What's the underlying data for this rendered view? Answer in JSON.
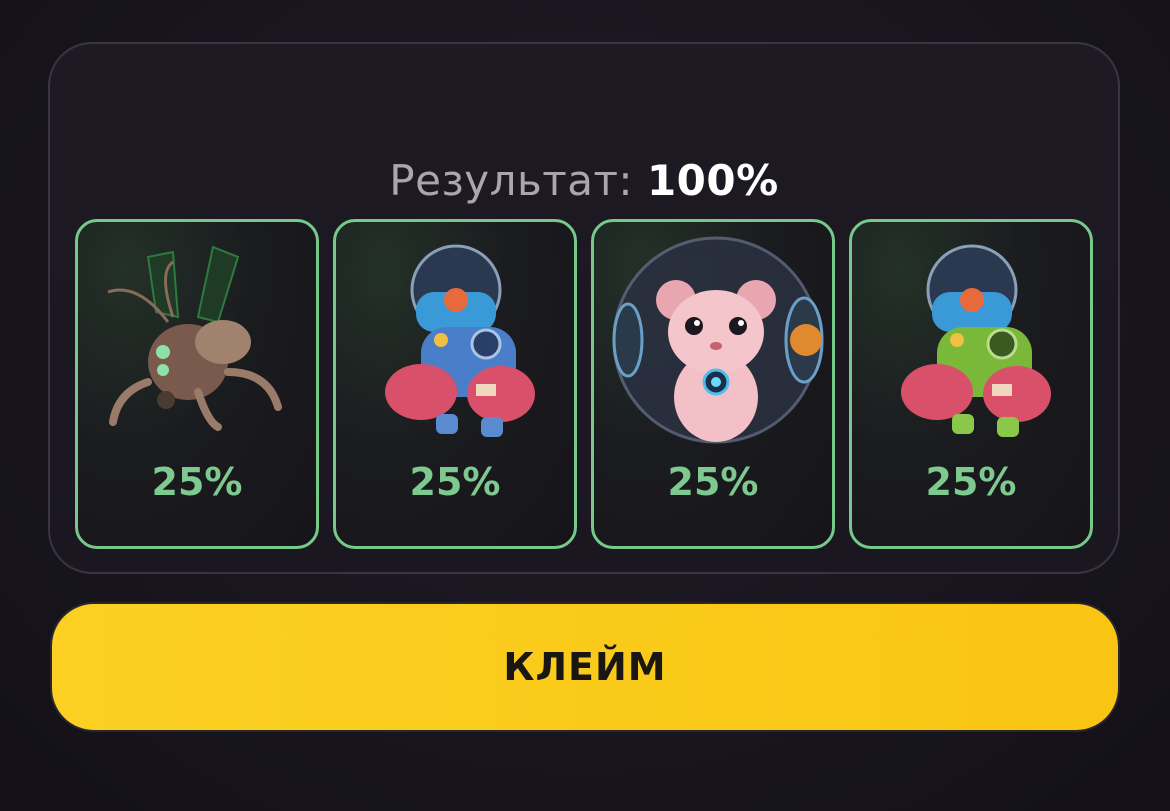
{
  "result": {
    "label": "Результат:",
    "value": "100%"
  },
  "cards": [
    {
      "icon": "bug-mech-icon",
      "percent": "25%"
    },
    {
      "icon": "fishbowl-mech-blue-icon",
      "percent": "25%"
    },
    {
      "icon": "hamster-ball-icon",
      "percent": "25%"
    },
    {
      "icon": "fishbowl-mech-green-icon",
      "percent": "25%"
    }
  ],
  "claim_button": {
    "label": "КЛЕЙМ"
  },
  "colors": {
    "accent_green": "#7ec98f",
    "button_yellow": "#fbcb1a",
    "background": "#17141c"
  }
}
